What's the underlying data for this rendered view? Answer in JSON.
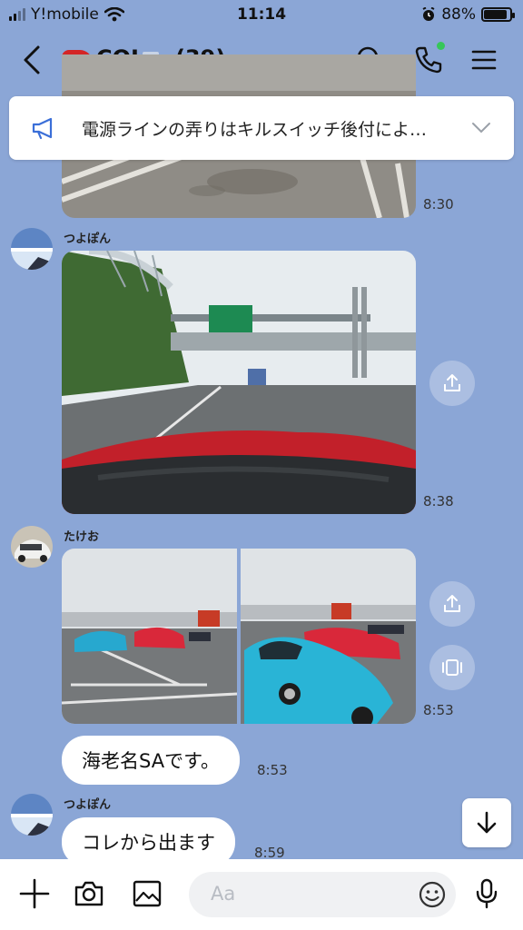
{
  "status_bar": {
    "carrier": "Y!mobile",
    "time": "11:14",
    "battery": "88%",
    "battery_level": 0.88
  },
  "header": {
    "title": "COJ",
    "member_count": "(39)"
  },
  "announcement": {
    "text": "電源ラインの弄りはキルスイッチ後付によ…"
  },
  "messages": [
    {
      "type": "image",
      "time": "8:30"
    },
    {
      "type": "image",
      "sender": "つよぽん",
      "time": "8:38"
    },
    {
      "type": "image-pair",
      "sender": "たけお",
      "time": "8:53"
    },
    {
      "type": "text",
      "text": "海老名SAです。",
      "time": "8:53"
    },
    {
      "type": "text",
      "sender": "つよぽん",
      "text": "コレから出ます",
      "time": "8:59"
    }
  ],
  "input": {
    "placeholder": "Aa"
  },
  "icons": [
    "back-arrow-icon",
    "search-icon",
    "phone-icon",
    "menu-icon",
    "megaphone-icon",
    "chevron-down-icon",
    "share-icon",
    "album-icon",
    "arrow-down-icon",
    "plus-icon",
    "camera-icon",
    "image-icon",
    "emoji-icon",
    "microphone-icon"
  ],
  "colors": {
    "chat_background": "#8ba6d6",
    "online_dot": "#36c759"
  }
}
